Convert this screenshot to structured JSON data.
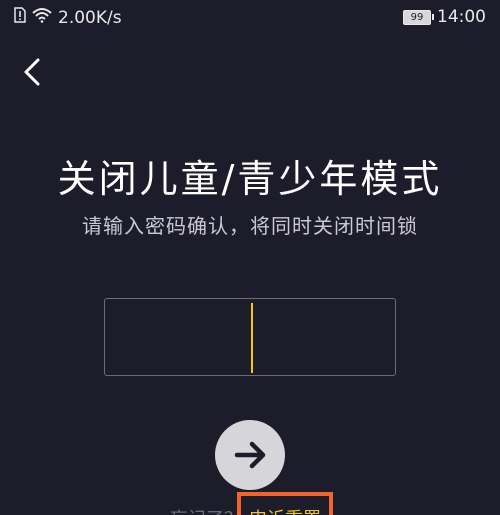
{
  "status_bar": {
    "network_speed": "2.00K/s",
    "battery_level": "99",
    "time": "14:00",
    "icons": [
      "sim-alert-icon",
      "wifi-icon",
      "battery-icon"
    ]
  },
  "header": {
    "back_icon": "chevron-left-icon"
  },
  "main": {
    "title": "关闭儿童/青少年模式",
    "subtitle": "请输入密码确认，将同时关闭时间锁"
  },
  "pin_input": {
    "value": ""
  },
  "actions": {
    "next_icon": "arrow-right-icon"
  },
  "footer": {
    "forgot_text": "忘记了？",
    "reset_label": "申诉重置"
  },
  "colors": {
    "background": "#1d1c2a",
    "accent": "#f4c417",
    "highlight_border": "#f0662a",
    "button_bg": "#d6d5da"
  }
}
